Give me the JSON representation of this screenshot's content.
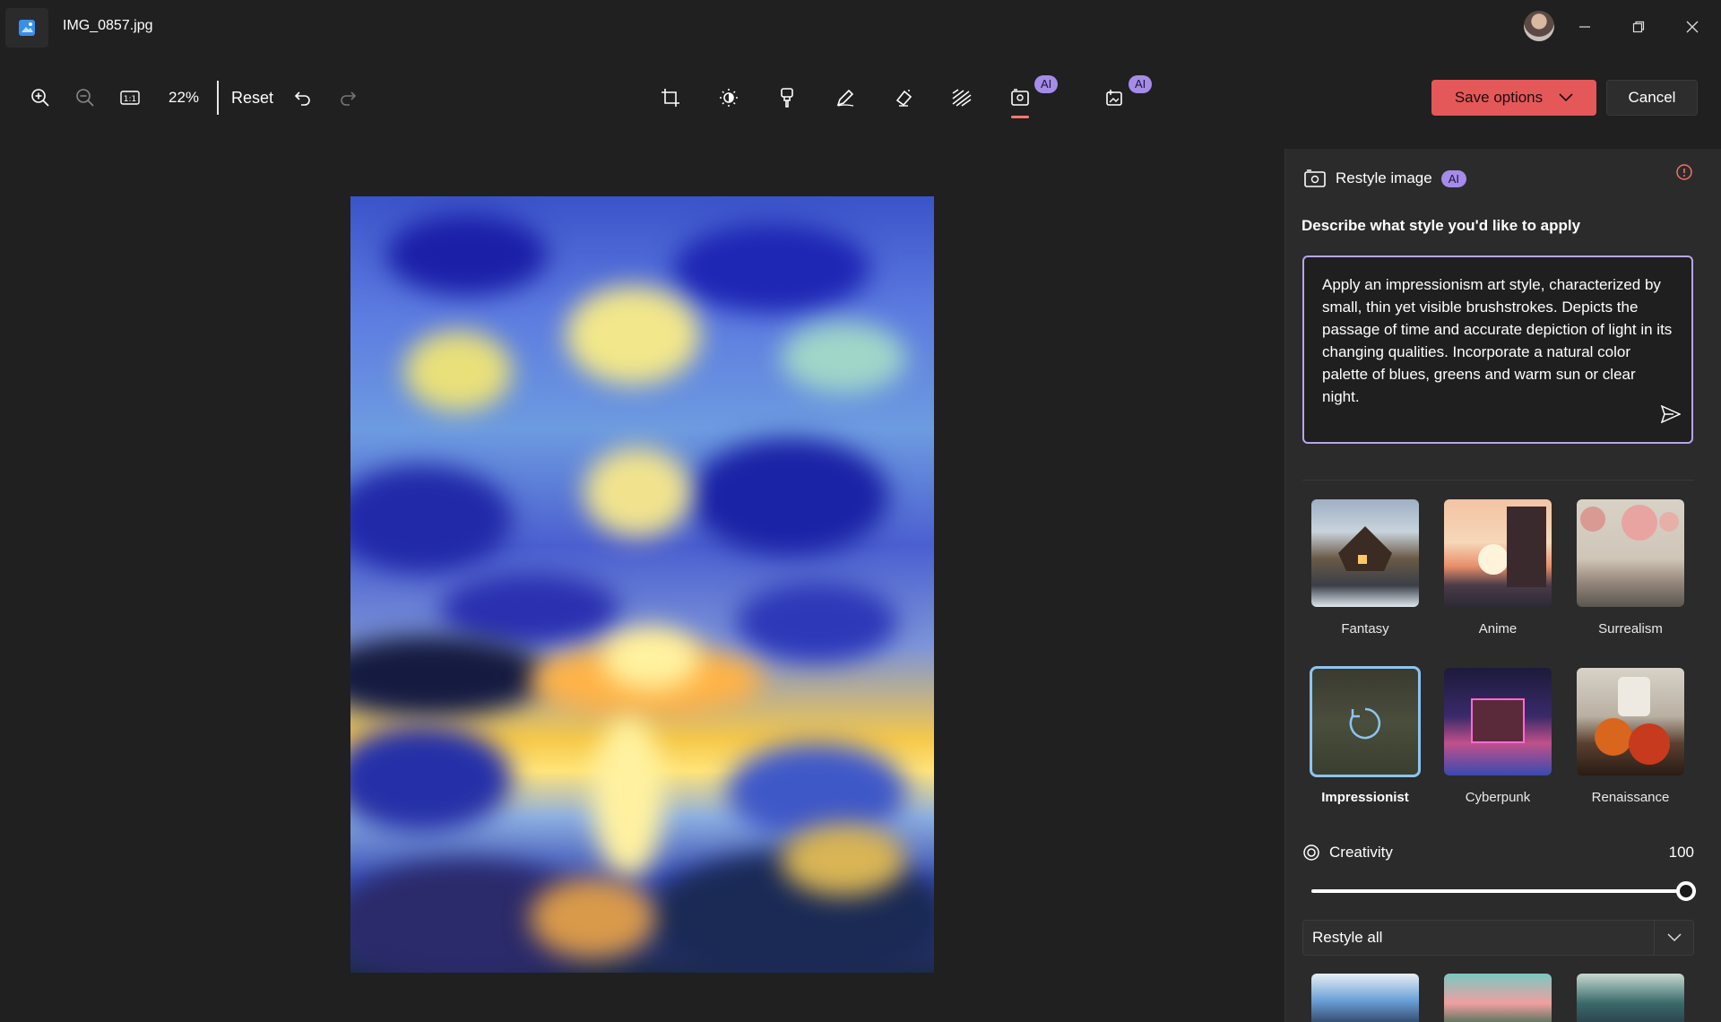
{
  "window": {
    "title": "IMG_0857.jpg"
  },
  "toolbar": {
    "zoom": "22%",
    "reset_label": "Reset",
    "tools": [
      {
        "icon": "crop-icon"
      },
      {
        "icon": "brightness-icon"
      },
      {
        "icon": "filter-icon"
      },
      {
        "icon": "markup-icon"
      },
      {
        "icon": "erase-icon"
      },
      {
        "icon": "background-blur-icon"
      },
      {
        "icon": "restyle-icon",
        "badge": "AI",
        "active": true
      },
      {
        "icon": "generative-fill-icon",
        "badge": "AI"
      }
    ],
    "save_label": "Save options",
    "cancel_label": "Cancel"
  },
  "panel": {
    "title": "Restyle image",
    "badge": "AI",
    "prompt_label": "Describe what style you'd like to apply",
    "prompt_text": "Apply an impressionism art style, characterized by small, thin yet visible brushstrokes. Depicts the passage of time and accurate depiction of light in its changing qualities. Incorporate a natural color palette of blues, greens and warm sun or clear night.",
    "styles": [
      {
        "label": "Fantasy"
      },
      {
        "label": "Anime"
      },
      {
        "label": "Surrealism"
      },
      {
        "label": "Impressionist",
        "selected": true
      },
      {
        "label": "Cyberpunk"
      },
      {
        "label": "Renaissance"
      }
    ],
    "creativity_label": "Creativity",
    "creativity_value": "100",
    "creativity_level": 1.0,
    "scope_value": "Restyle all"
  },
  "colors": {
    "accent_save": "#e5585a",
    "ai_badge": "#a58ce8",
    "prompt_border": "#b8a6e8",
    "active_tool_underline": "#ff7a6e"
  }
}
